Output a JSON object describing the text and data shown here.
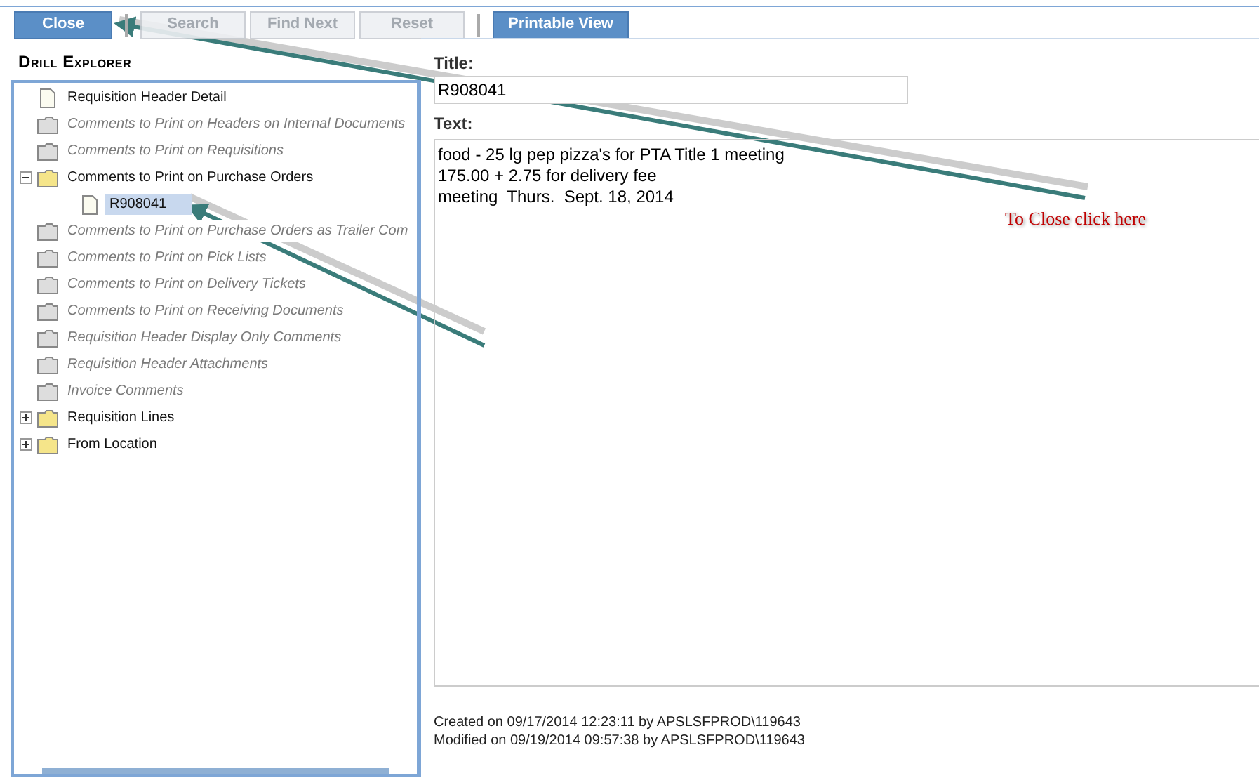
{
  "toolbar": [
    {
      "label": "Close",
      "disabled": false,
      "kind": "primary"
    },
    {
      "label": "Search",
      "disabled": true,
      "kind": "plain"
    },
    {
      "label": "Find Next",
      "disabled": true,
      "kind": "plain"
    },
    {
      "label": "Reset",
      "disabled": true,
      "kind": "plain"
    },
    {
      "label": "Printable View",
      "disabled": false,
      "kind": "primary"
    }
  ],
  "panel_title": "Drill Explorer",
  "tree": [
    {
      "label": "Requisition Header Detail",
      "kind": "document",
      "disabled": false,
      "selected": false
    },
    {
      "label": "Comments to Print on Headers on Internal Documents",
      "kind": "folder",
      "disabled": true,
      "selected": false
    },
    {
      "label": "Comments to Print on Requisitions",
      "kind": "folder",
      "disabled": true,
      "selected": false
    },
    {
      "label": "Comments to Print on Purchase Orders",
      "kind": "folder",
      "disabled": false,
      "selected": false,
      "expanded": true,
      "children": [
        {
          "label": "R908041",
          "kind": "document",
          "disabled": false,
          "selected": true
        }
      ]
    },
    {
      "label": "Comments to Print on Purchase Orders as Trailer Com",
      "kind": "folder",
      "disabled": true,
      "selected": false
    },
    {
      "label": "Comments to Print on Pick Lists",
      "kind": "folder",
      "disabled": true,
      "selected": false
    },
    {
      "label": "Comments to Print on Delivery Tickets",
      "kind": "folder",
      "disabled": true,
      "selected": false
    },
    {
      "label": "Comments to Print on Receiving Documents",
      "kind": "folder",
      "disabled": true,
      "selected": false
    },
    {
      "label": "Requisition Header Display Only Comments",
      "kind": "folder",
      "disabled": true,
      "selected": false
    },
    {
      "label": "Requisition Header Attachments",
      "kind": "folder",
      "disabled": true,
      "selected": false
    },
    {
      "label": "Invoice Comments",
      "kind": "folder",
      "disabled": true,
      "selected": false
    },
    {
      "label": "Requisition Lines",
      "kind": "folder",
      "disabled": false,
      "selected": false,
      "expanded": false
    },
    {
      "label": "From Location",
      "kind": "folder",
      "disabled": false,
      "selected": false,
      "expanded": false
    }
  ],
  "detail": {
    "title_label": "Title:",
    "title_value": "R908041",
    "text_label": "Text:",
    "text_lines": [
      "food - 25 lg pep pizza's for PTA Title 1 meeting",
      "175.00 + 2.75 for delivery fee",
      "meeting  Thurs.  Sept. 18, 2014"
    ],
    "created": "Created on 09/17/2014 12:23:11 by APSLSFPROD\\119643",
    "modified": "Modified on 09/19/2014 09:57:38 by APSLSFPROD\\119643"
  },
  "annotation": {
    "text": "To Close click here"
  }
}
